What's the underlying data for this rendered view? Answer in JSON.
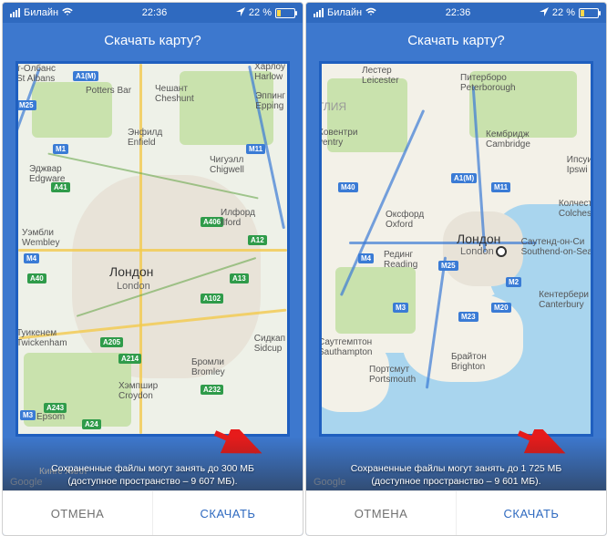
{
  "statusbar": {
    "carrier": "Билайн",
    "wifi_icon": "wifi-icon",
    "time": "22:36",
    "location_icon": "location-icon",
    "battery_pct": "22 %"
  },
  "title": "Скачать карту?",
  "attribution": "Google",
  "buttons": {
    "cancel": "ОТМЕНА",
    "download": "СКАЧАТЬ"
  },
  "left": {
    "info_line1": "Сохраненные файлы могут занять до 300 МБ",
    "info_line2": "(доступное пространство – 9 607 МБ).",
    "center_city_ru": "Лондон",
    "center_city_en": "London",
    "labels": {
      "st_albans": "т-Олбанс\nSt Albans",
      "harlow": "Харлоу\nHarlow",
      "potters_bar": "Potters Bar",
      "cheshunt": "Чешант\nCheshunt",
      "epping": "Эппинг\nEpping",
      "enfield": "Энфилд\nEnfield",
      "chigwell": "Чигуэлл\nChigwell",
      "edgware": "Эджвар\nEdgware",
      "wembley": "Уэмбли\nWembley",
      "ilford": "Илфорд\nIlford",
      "twickenham": "Туикенем\nTwickenham",
      "sidcup": "Сидкап\nSidcup",
      "bromley": "Бромли\nBromley",
      "croydon": "Хэмпшир\nCroydon",
      "epsom": "Epsom",
      "kings": "Кингс Хилл"
    },
    "hwy": {
      "m25": "M25",
      "a1m": "A1(M)",
      "m1": "M1",
      "m11": "M11",
      "m4": "M4",
      "a41": "A41",
      "a13": "A13",
      "a40": "A40",
      "a406": "A406",
      "a12": "A12",
      "a102": "A102",
      "a205": "A205",
      "a214": "A214",
      "a232": "A232",
      "a243": "A243",
      "a24": "A24",
      "m3": "M3"
    }
  },
  "right": {
    "info_line1": "Сохраненные файлы могут занять до 1 725 МБ",
    "info_line2": "(доступное пространство – 9 601 МБ).",
    "labels": {
      "leicester": "Лестер\nLeicester",
      "peterborough": "Питерборо\nPeterborough",
      "cambridge": "Кембридж\nCambridge",
      "coventry": "Ковентри\nventry",
      "oxford": "Оксфорд\nOxford",
      "reading": "Рединг\nReading",
      "london_ru": "Лондон",
      "london_en": "London",
      "southend": "Саутенд-он-Си\nSouthend-on-Sea",
      "canterbury": "Кентербери\nCanterbury",
      "brighton": "Брайтон\nBrighton",
      "portsmouth": "Портсмут\nPortsmouth",
      "southampton": "Саутгемптон\nSauthampton",
      "colchester": "Колчест\nColches",
      "ipswich": "Ипсуи\nIpswi",
      "gliya": "ГЛИЯ"
    },
    "hwy": {
      "m40": "M40",
      "a1m": "A1(M)",
      "m11": "M11",
      "m4": "M4",
      "m25": "M25",
      "m20": "M20",
      "m3": "M3",
      "m23": "M23",
      "m2": "M2"
    }
  }
}
